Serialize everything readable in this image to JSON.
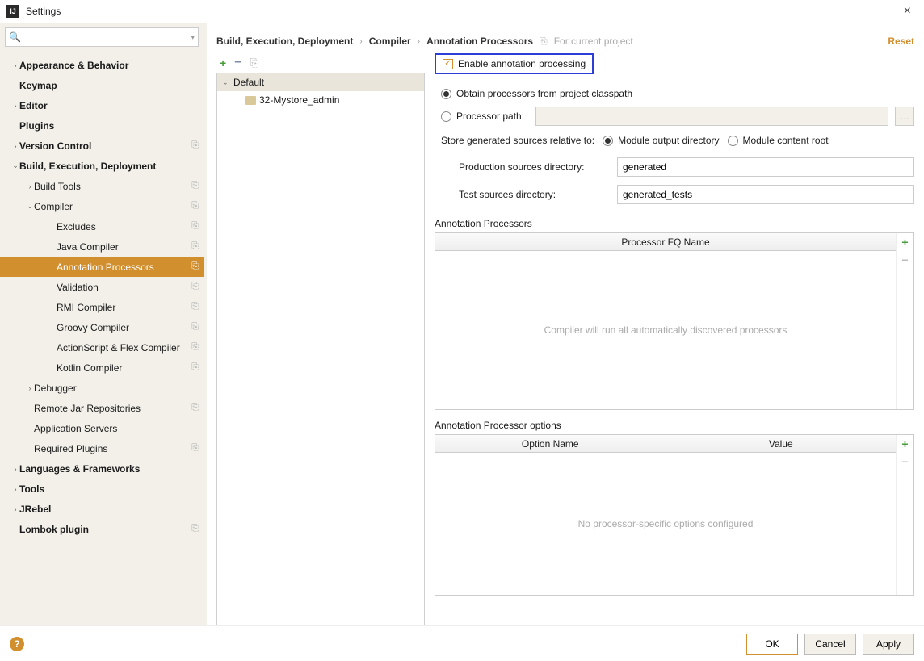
{
  "window": {
    "title": "Settings"
  },
  "search": {
    "placeholder": ""
  },
  "tree": [
    {
      "label": "Appearance & Behavior",
      "bold": true,
      "indent": 0,
      "chev": "›",
      "proj": false
    },
    {
      "label": "Keymap",
      "bold": true,
      "indent": 0,
      "chev": "",
      "proj": false
    },
    {
      "label": "Editor",
      "bold": true,
      "indent": 0,
      "chev": "›",
      "proj": false
    },
    {
      "label": "Plugins",
      "bold": true,
      "indent": 0,
      "chev": "",
      "proj": false
    },
    {
      "label": "Version Control",
      "bold": true,
      "indent": 0,
      "chev": "›",
      "proj": true
    },
    {
      "label": "Build, Execution, Deployment",
      "bold": true,
      "indent": 0,
      "chev": "⌄",
      "proj": false
    },
    {
      "label": "Build Tools",
      "bold": false,
      "indent": 1,
      "chev": "›",
      "proj": true
    },
    {
      "label": "Compiler",
      "bold": false,
      "indent": 1,
      "chev": "⌄",
      "proj": true
    },
    {
      "label": "Excludes",
      "bold": false,
      "indent": 3,
      "chev": "",
      "proj": true
    },
    {
      "label": "Java Compiler",
      "bold": false,
      "indent": 3,
      "chev": "",
      "proj": true
    },
    {
      "label": "Annotation Processors",
      "bold": false,
      "indent": 3,
      "chev": "",
      "proj": true,
      "selected": true
    },
    {
      "label": "Validation",
      "bold": false,
      "indent": 3,
      "chev": "",
      "proj": true
    },
    {
      "label": "RMI Compiler",
      "bold": false,
      "indent": 3,
      "chev": "",
      "proj": true
    },
    {
      "label": "Groovy Compiler",
      "bold": false,
      "indent": 3,
      "chev": "",
      "proj": true
    },
    {
      "label": "ActionScript & Flex Compiler",
      "bold": false,
      "indent": 3,
      "chev": "",
      "proj": true
    },
    {
      "label": "Kotlin Compiler",
      "bold": false,
      "indent": 3,
      "chev": "",
      "proj": true
    },
    {
      "label": "Debugger",
      "bold": false,
      "indent": 1,
      "chev": "›",
      "proj": false
    },
    {
      "label": "Remote Jar Repositories",
      "bold": false,
      "indent": 1,
      "chev": "",
      "proj": true
    },
    {
      "label": "Application Servers",
      "bold": false,
      "indent": 1,
      "chev": "",
      "proj": false
    },
    {
      "label": "Required Plugins",
      "bold": false,
      "indent": 1,
      "chev": "",
      "proj": true
    },
    {
      "label": "Languages & Frameworks",
      "bold": true,
      "indent": 0,
      "chev": "›",
      "proj": false
    },
    {
      "label": "Tools",
      "bold": true,
      "indent": 0,
      "chev": "›",
      "proj": false
    },
    {
      "label": "JRebel",
      "bold": true,
      "indent": 0,
      "chev": "›",
      "proj": false
    },
    {
      "label": "Lombok plugin",
      "bold": true,
      "indent": 0,
      "chev": "",
      "proj": true
    }
  ],
  "breadcrumb": {
    "c1": "Build, Execution, Deployment",
    "c2": "Compiler",
    "c3": "Annotation Processors",
    "scope": "For current project",
    "reset": "Reset"
  },
  "profiles": {
    "default": "Default",
    "project": "32-Mystore_admin"
  },
  "form": {
    "enable": "Enable annotation processing",
    "obtain": "Obtain processors from project classpath",
    "processor_path": "Processor path:",
    "store": "Store generated sources relative to:",
    "module_out": "Module output directory",
    "module_root": "Module content root",
    "prod_dir_label": "Production sources directory:",
    "prod_dir_value": "generated",
    "test_dir_label": "Test sources directory:",
    "test_dir_value": "generated_tests",
    "ap_section": "Annotation Processors",
    "ap_col": "Processor FQ Name",
    "ap_empty": "Compiler will run all automatically discovered processors",
    "opt_section": "Annotation Processor options",
    "opt_col1": "Option Name",
    "opt_col2": "Value",
    "opt_empty": "No processor-specific options configured"
  },
  "footer": {
    "ok": "OK",
    "cancel": "Cancel",
    "apply": "Apply"
  }
}
